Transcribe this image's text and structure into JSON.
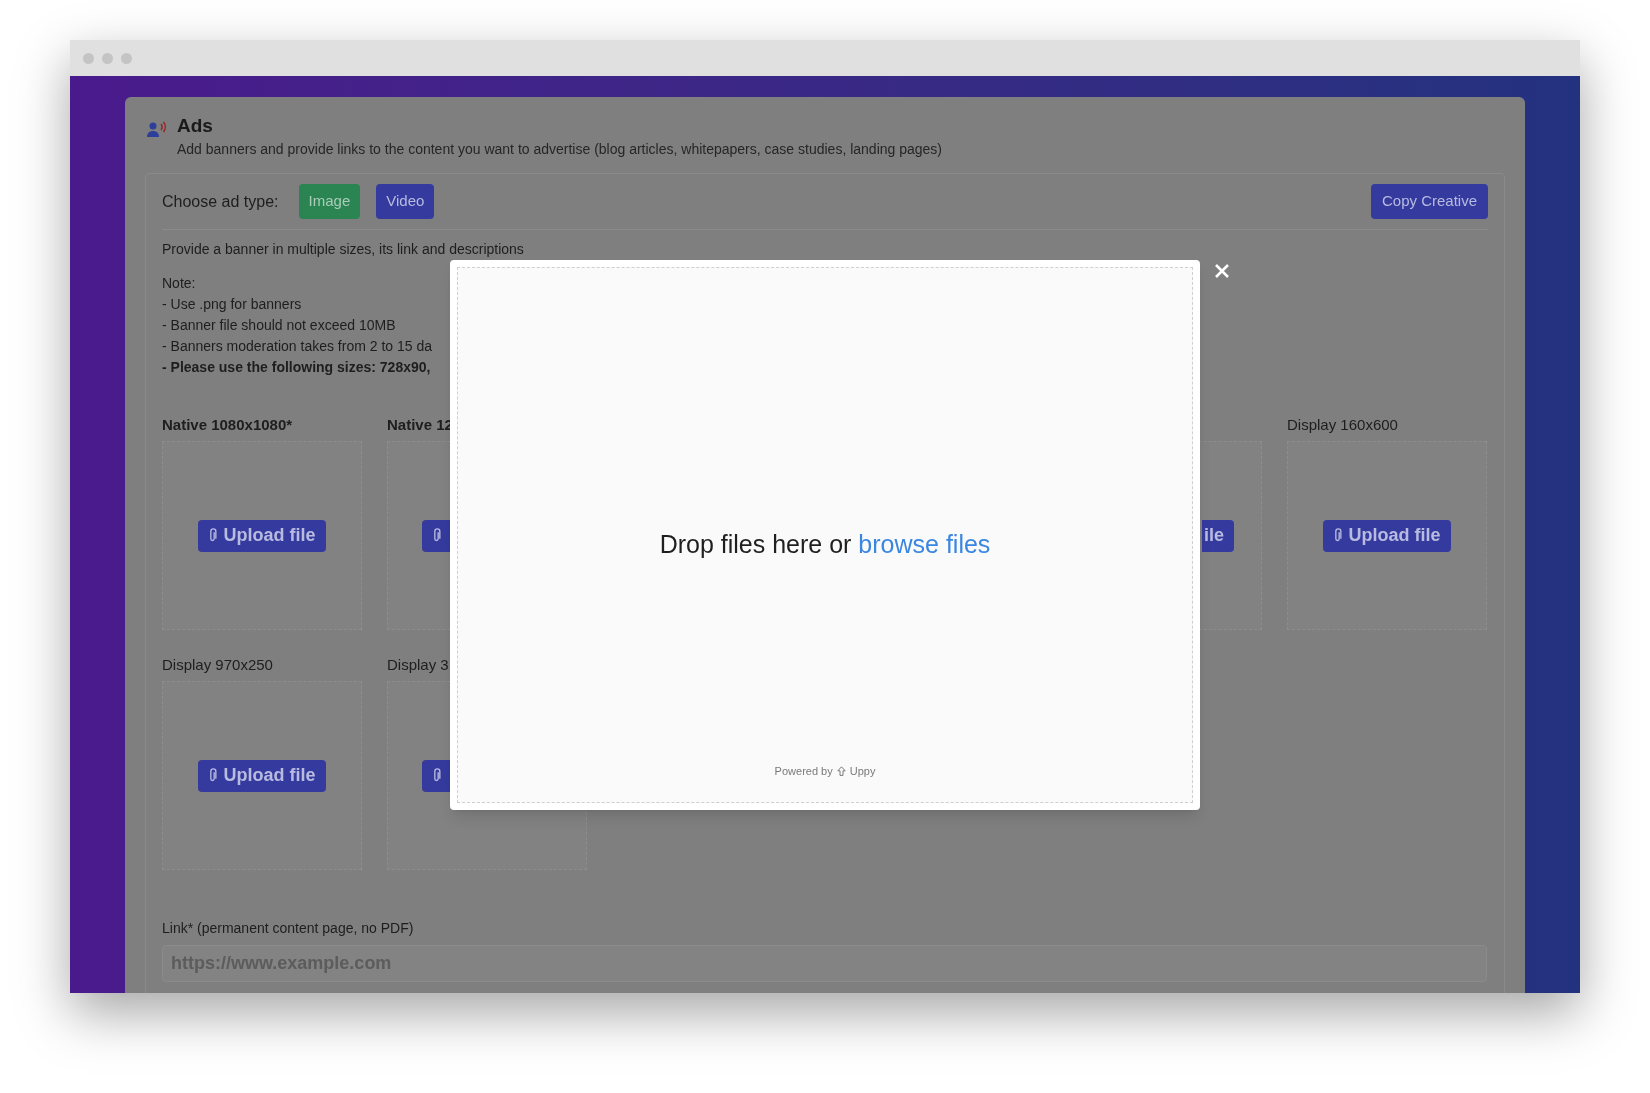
{
  "header": {
    "title": "Ads",
    "subtitle": "Add banners and provide links to the content you want to advertise (blog articles, whitepapers, case studies, landing pages)"
  },
  "ad_type": {
    "label": "Choose ad type:",
    "options": [
      {
        "label": "Image",
        "selected": true
      },
      {
        "label": "Video",
        "selected": false
      }
    ]
  },
  "copy_button": "Copy Creative",
  "intro": "Provide a banner in multiple sizes, its link and descriptions",
  "notes": [
    {
      "text": "Note:",
      "bold": false
    },
    {
      "text": "- Use .png for banners",
      "bold": false
    },
    {
      "text": "- Banner file should not exceed 10MB",
      "bold": false
    },
    {
      "text": "- Banners moderation takes from 2 to 15 da",
      "bold": false
    },
    {
      "text": "- Please use the following sizes: 728x90,",
      "bold": true
    }
  ],
  "banner_rows": [
    [
      {
        "kind": "full",
        "label": "Native 1080x1080*",
        "bold": true,
        "button": "Upload file"
      },
      {
        "kind": "cut_right",
        "label": "Native 12",
        "bold": true
      },
      {
        "kind": "hidden"
      },
      {
        "kind": "hidden"
      },
      {
        "kind": "cut_left",
        "button": "ile"
      },
      {
        "kind": "full",
        "label": "Display 160x600",
        "bold": false,
        "button": "Upload file"
      }
    ],
    [
      {
        "kind": "full",
        "label": "Display 970x250",
        "bold": false,
        "button": "Upload file"
      },
      {
        "kind": "cut_right",
        "label": "Display 3",
        "bold": false
      }
    ]
  ],
  "link": {
    "label": "Link* (permanent content page, no PDF)",
    "placeholder": "https://www.example.com"
  },
  "modal": {
    "prompt": "Drop files here or",
    "link": "browse files",
    "footer": "Powered by",
    "brand": "Uppy"
  }
}
